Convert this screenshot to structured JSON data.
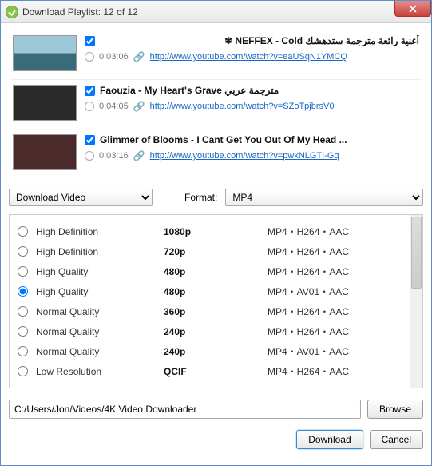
{
  "window": {
    "title": "Download Playlist: 12 of 12"
  },
  "playlist": [
    {
      "title": "أغنية رائعة مترجمة ستدهشك NEFFEX - Cold ❄",
      "duration": "0:03:06",
      "url": "http://www.youtube.com/watch?v=eaUSqN1YMCQ",
      "rtl": true
    },
    {
      "title": "Faouzia - My Heart's Grave مترجمة عربي",
      "duration": "0:04:05",
      "url": "http://www.youtube.com/watch?v=SZoTpjbrsV0",
      "rtl": false
    },
    {
      "title": "Glimmer of Blooms - I Cant Get You Out Of My Head ...",
      "duration": "0:03:16",
      "url": "http://www.youtube.com/watch?v=pwkNLGTI-Gq",
      "rtl": false
    }
  ],
  "action_select": "Download Video",
  "format_label": "Format:",
  "format_select": "MP4",
  "qualities": [
    {
      "name": "High Definition",
      "res": "1080p",
      "codec": "MP4・H264・AAC",
      "selected": false
    },
    {
      "name": "High Definition",
      "res": "720p",
      "codec": "MP4・H264・AAC",
      "selected": false
    },
    {
      "name": "High Quality",
      "res": "480p",
      "codec": "MP4・H264・AAC",
      "selected": false
    },
    {
      "name": "High Quality",
      "res": "480p",
      "codec": "MP4・AV01・AAC",
      "selected": true
    },
    {
      "name": "Normal Quality",
      "res": "360p",
      "codec": "MP4・H264・AAC",
      "selected": false
    },
    {
      "name": "Normal Quality",
      "res": "240p",
      "codec": "MP4・H264・AAC",
      "selected": false
    },
    {
      "name": "Normal Quality",
      "res": "240p",
      "codec": "MP4・AV01・AAC",
      "selected": false
    },
    {
      "name": "Low Resolution",
      "res": "QCIF",
      "codec": "MP4・H264・AAC",
      "selected": false
    }
  ],
  "path": "C:/Users/Jon/Videos/4K Video Downloader",
  "buttons": {
    "browse": "Browse",
    "download": "Download",
    "cancel": "Cancel"
  }
}
